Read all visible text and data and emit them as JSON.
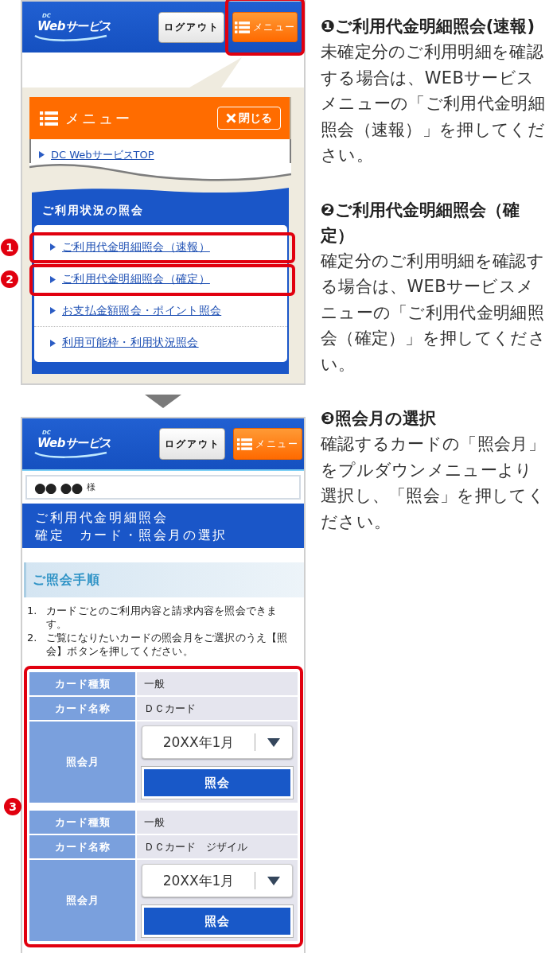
{
  "top_screen": {
    "header": {
      "logo_prefix": "DC",
      "logo_text": "Webサービス",
      "logout_button": "ログアウト",
      "menu_button": {
        "label": "メニュー",
        "highlighted": true
      }
    },
    "menu_panel": {
      "title": "メニュー",
      "close_button": "閉じる",
      "top_link": "DC WebサービスTOP",
      "section": {
        "title": "ご利用状況の照会",
        "items": [
          {
            "label": "ご利用代金明細照会（速報）",
            "highlighted": true,
            "marker": "1"
          },
          {
            "label": "ご利用代金明細照会（確定）",
            "highlighted": true,
            "marker": "2"
          },
          {
            "label": "お支払金額照会・ポイント照会",
            "highlighted": false
          },
          {
            "label": "利用可能枠・利用状況照会",
            "highlighted": false
          }
        ]
      }
    }
  },
  "bottom_screen": {
    "header": {
      "logo_prefix": "DC",
      "logo_text": "Webサービス",
      "logout_button": "ログアウト",
      "menu_button": {
        "label": "メニュー",
        "highlighted": false
      }
    },
    "user_name": "●● ●●",
    "user_suffix": "様",
    "page_title": [
      "ご利用代金明細照会",
      "確定　カード・照会月の選択"
    ],
    "steps_title": "ご照会手順",
    "steps": [
      {
        "number": "1.",
        "text": "カードごとのご利用内容と請求内容を照会できます。"
      },
      {
        "number": "2.",
        "text": "ご覧になりたいカードの照会月をご選択のうえ【照会】ボタンを押してください。"
      }
    ],
    "cards": {
      "highlighted": true,
      "marker": "3",
      "items": [
        {
          "rows": [
            {
              "label": "カード種類",
              "value": "一般"
            },
            {
              "label": "カード名称",
              "value": "ＤＣカード"
            }
          ],
          "month_label": "照会月",
          "month_value": "20XX年1月",
          "submit_button": "照会"
        },
        {
          "rows": [
            {
              "label": "カード種類",
              "value": "一般"
            },
            {
              "label": "カード名称",
              "value": "ＤＣカード　ジザイル"
            }
          ],
          "month_label": "照会月",
          "month_value": "20XX年1月",
          "submit_button": "照会"
        }
      ]
    }
  },
  "instructions": [
    {
      "title": "❶ご利用代金明細照会(速報)",
      "text": "未確定分のご利用明細を確認する場合は、WEBサービスメニューの「ご利用代金明細照会（速報）」を押してください。"
    },
    {
      "title": "❷ご利用代金明細照会（確定）",
      "text": "確定分のご利用明細を確認する場合は、WEBサービスメニューの「ご利用代金明細照会（確定）」を押してください。"
    },
    {
      "title": "❸照会月の選択",
      "text": "確認するカードの「照会月」をプルダウンメニューより選択し、「照会」を押してください。"
    }
  ]
}
